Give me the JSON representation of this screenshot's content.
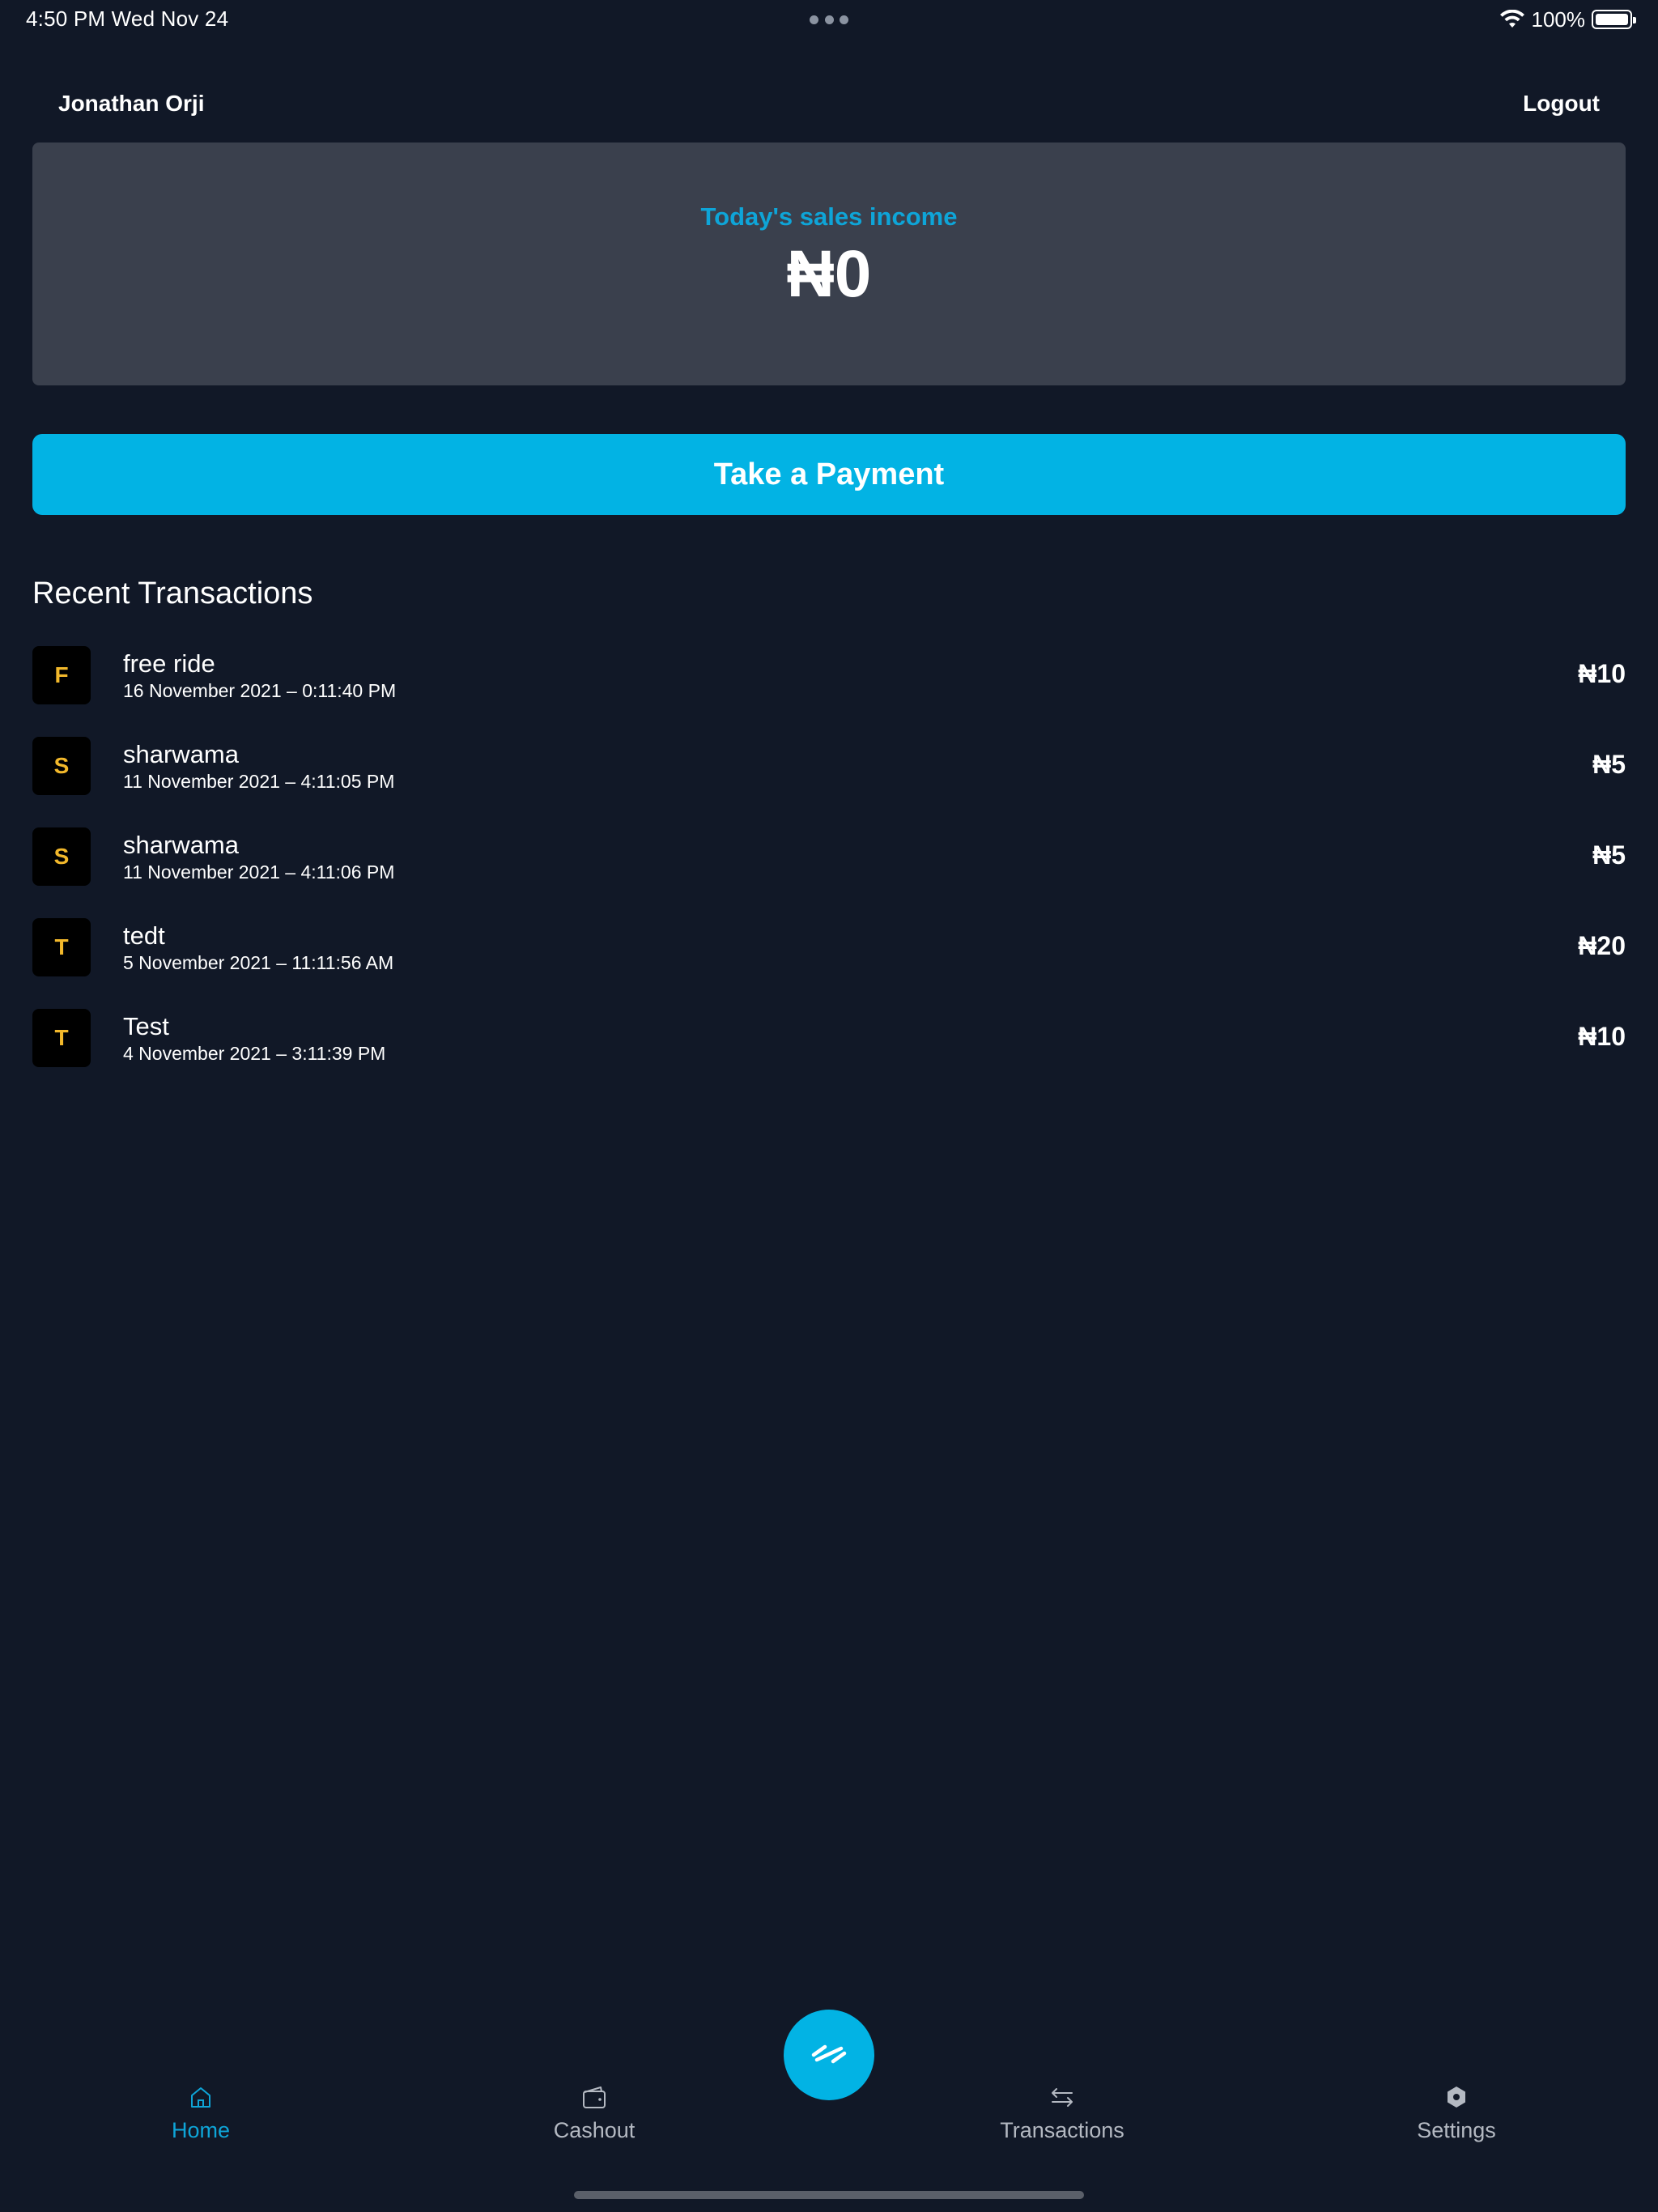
{
  "status_bar": {
    "time": "4:50 PM   Wed Nov 24",
    "battery": "100%",
    "battery_level": 1.0
  },
  "header": {
    "user_name": "Jonathan Orji",
    "logout_label": "Logout"
  },
  "sales": {
    "label": "Today's sales income",
    "amount": "₦0"
  },
  "pay_button_label": "Take a Payment",
  "recent": {
    "title": "Recent Transactions",
    "items": [
      {
        "initial": "F",
        "name": "free ride",
        "date": "16 November 2021 – 0:11:40 PM",
        "amount": "₦10"
      },
      {
        "initial": "S",
        "name": "sharwama",
        "date": "11 November 2021 – 4:11:05 PM",
        "amount": "₦5"
      },
      {
        "initial": "S",
        "name": "sharwama",
        "date": "11 November 2021 – 4:11:06 PM",
        "amount": "₦5"
      },
      {
        "initial": "T",
        "name": "tedt",
        "date": "5 November 2021 – 11:11:56 AM",
        "amount": "₦20"
      },
      {
        "initial": "T",
        "name": "Test",
        "date": "4 November 2021 – 3:11:39 PM",
        "amount": "₦10"
      }
    ]
  },
  "nav": {
    "items": [
      {
        "label": "Home",
        "icon": "home-icon",
        "active": true
      },
      {
        "label": "Cashout",
        "icon": "wallet-icon",
        "active": false
      },
      {
        "label": "Transactions",
        "icon": "swap-arrows-icon",
        "active": false
      },
      {
        "label": "Settings",
        "icon": "hexagon-gear-icon",
        "active": false
      }
    ],
    "fab_icon": "transfer-icon"
  },
  "colors": {
    "background": "#111827",
    "card": "#3a404d",
    "accent": "#02b3e4",
    "avatar_letter": "#f2b82b",
    "nav_inactive": "#b4b9c2"
  }
}
